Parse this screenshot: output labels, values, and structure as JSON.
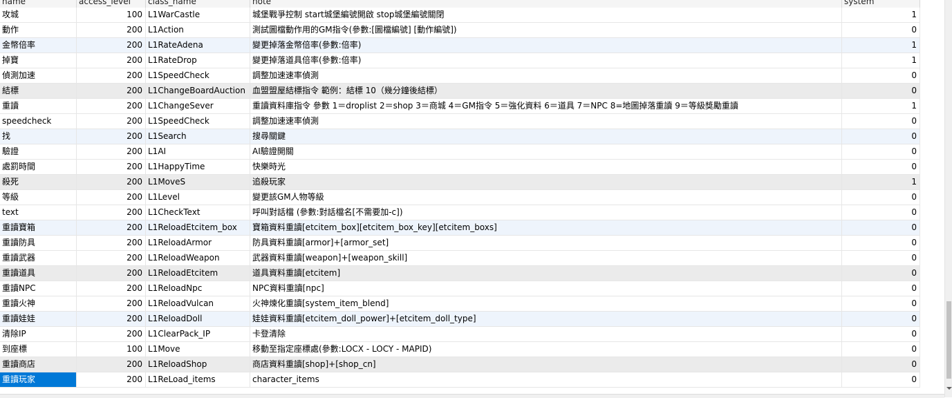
{
  "columns": {
    "name": "name",
    "access_level": "access_level",
    "class_name": "class_name",
    "note": "note",
    "system": "system"
  },
  "rows": [
    {
      "name": "攻城",
      "level": "100",
      "class": "L1WarCastle",
      "note": "城堡戰爭控制 start城堡編號開啟 stop城堡編號關閉",
      "system": "1",
      "bg": "white"
    },
    {
      "name": "動作",
      "level": "200",
      "class": "L1Action",
      "note": "測試圖檔動作用的GM指令(參數:[圖檔編號] [動作編號])",
      "system": "0",
      "bg": "white"
    },
    {
      "name": "金幣倍率",
      "level": "200",
      "class": "L1RateAdena",
      "note": "變更掉落金幣倍率(參數:倍率)",
      "system": "1",
      "bg": "blue"
    },
    {
      "name": "掉寶",
      "level": "200",
      "class": "L1RateDrop",
      "note": "變更掉落道具倍率(參數:倍率)",
      "system": "1",
      "bg": "white"
    },
    {
      "name": "偵測加速",
      "level": "200",
      "class": "L1SpeedCheck",
      "note": "調整加速速率偵測",
      "system": "0",
      "bg": "white"
    },
    {
      "name": "結標",
      "level": "200",
      "class": "L1ChangeBoardAuction",
      "note": "血盟盟屋結標指令 範例：結標 10（幾分鐘後結標）",
      "system": "0",
      "bg": "alt"
    },
    {
      "name": "重讀",
      "level": "200",
      "class": "L1ChangeSever",
      "note": "重讀資料庫指令 參數 1＝droplist 2＝shop 3＝商城 4＝GM指令 5＝強化資料 6＝道具 7＝NPC 8=地圖掉落重讀 9＝等級獎勵重讀",
      "system": "1",
      "bg": "white"
    },
    {
      "name": "speedcheck",
      "level": "200",
      "class": "L1SpeedCheck",
      "note": "調整加速速率偵測",
      "system": "0",
      "bg": "white"
    },
    {
      "name": "找",
      "level": "200",
      "class": "L1Search",
      "note": "搜尋關鍵",
      "system": "0",
      "bg": "blue"
    },
    {
      "name": "驗證",
      "level": "200",
      "class": "L1AI",
      "note": "AI驗證開關",
      "system": "0",
      "bg": "white"
    },
    {
      "name": "處罰時間",
      "level": "200",
      "class": "L1HappyTime",
      "note": "快樂時光",
      "system": "0",
      "bg": "white"
    },
    {
      "name": "殺死",
      "level": "200",
      "class": "L1MoveS",
      "note": "追殺玩家",
      "system": "1",
      "bg": "alt"
    },
    {
      "name": "等級",
      "level": "200",
      "class": "L1Level",
      "note": "變更該GM人物等級",
      "system": "0",
      "bg": "white"
    },
    {
      "name": "text",
      "level": "200",
      "class": "L1CheckText",
      "note": "呼叫對話檔 (參數:對話檔名[不需要加-c])",
      "system": "0",
      "bg": "white"
    },
    {
      "name": "重讀寶箱",
      "level": "200",
      "class": "L1ReloadEtcitem_box",
      "note": "寶箱資料重讀[etcitem_box][etcitem_box_key][etcitem_boxs]",
      "system": "0",
      "bg": "blue"
    },
    {
      "name": "重讀防具",
      "level": "200",
      "class": "L1ReloadArmor",
      "note": "防具資料重讀[armor]+[armor_set]",
      "system": "0",
      "bg": "white"
    },
    {
      "name": "重讀武器",
      "level": "200",
      "class": "L1ReloadWeapon",
      "note": "武器資料重讀[weapon]+[weapon_skill]",
      "system": "0",
      "bg": "white"
    },
    {
      "name": "重讀道具",
      "level": "200",
      "class": "L1ReloadEtcitem",
      "note": "道具資料重讀[etcitem]",
      "system": "0",
      "bg": "alt"
    },
    {
      "name": "重讀NPC",
      "level": "200",
      "class": "L1ReloadNpc",
      "note": "NPC資料重讀[npc]",
      "system": "0",
      "bg": "white"
    },
    {
      "name": "重讀火神",
      "level": "200",
      "class": "L1ReloadVulcan",
      "note": "火神煉化重讀[system_item_blend]",
      "system": "0",
      "bg": "white"
    },
    {
      "name": "重讀娃娃",
      "level": "200",
      "class": "L1ReloadDoll",
      "note": "娃娃資料重讀[etcitem_doll_power]+[etcitem_doll_type]",
      "system": "0",
      "bg": "blue"
    },
    {
      "name": "清除IP",
      "level": "200",
      "class": "L1ClearPack_IP",
      "note": "卡登清除",
      "system": "0",
      "bg": "white"
    },
    {
      "name": "到座標",
      "level": "100",
      "class": "L1Move",
      "note": "移動至指定座標處(參數:LOCX - LOCY - MAPID)",
      "system": "0",
      "bg": "white"
    },
    {
      "name": "重讀商店",
      "level": "200",
      "class": "L1ReloadShop",
      "note": "商店資料重讀[shop]+[shop_cn]",
      "system": "0",
      "bg": "alt"
    },
    {
      "name": "重讀玩家",
      "level": "200",
      "class": "L1ReLoad_items",
      "note": "character_items",
      "system": "0",
      "bg": "white",
      "selected": true
    }
  ]
}
